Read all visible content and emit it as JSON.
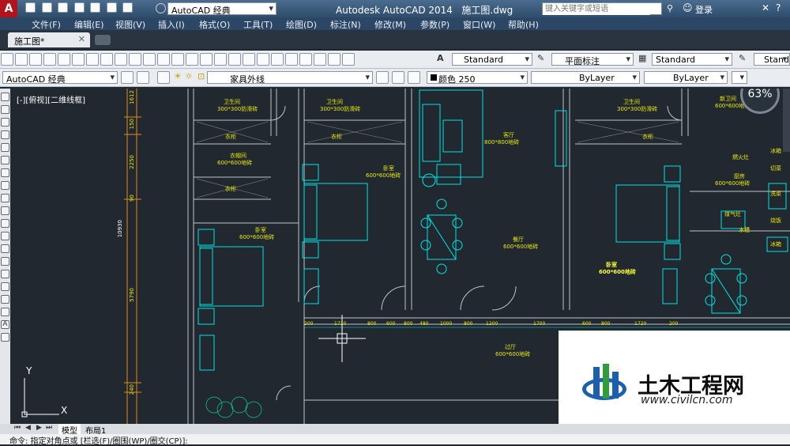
{
  "titlebar": {
    "app_icon": "A",
    "workspace": "AutoCAD 经典",
    "title_left": "Autodesk AutoCAD 2014",
    "title_file": "施工图.dwg",
    "search_placeholder": "键入关键字或短语",
    "login": "登录"
  },
  "menubar": {
    "items": [
      "文件(F)",
      "编辑(E)",
      "视图(V)",
      "插入(I)",
      "格式(O)",
      "工具(T)",
      "绘图(D)",
      "标注(N)",
      "修改(M)",
      "参数(P)",
      "窗口(W)",
      "帮助(H)"
    ]
  },
  "tabs": {
    "active": "施工图*"
  },
  "toolbar1": {
    "text_style": "Standard",
    "dim_style": "平面标注",
    "table_style": "Standard",
    "multileader_style": "Standa"
  },
  "toolbar2": {
    "workspace": "AutoCAD 经典",
    "layer": "家具外线",
    "color": "颜色 250",
    "linetype": "ByLayer",
    "lineweight": "ByLayer"
  },
  "viewport": {
    "label": "[-][俯视][二维线框]",
    "progress": "63%"
  },
  "dims": {
    "top": "1612",
    "d150": "150",
    "d2250": "2250",
    "d90": "90",
    "total": "10930",
    "d5790": "5790",
    "d240": "240"
  },
  "rooms": {
    "bath1": "卫生间",
    "bath1_tile": "300*300防滑砖",
    "bath2": "卫生间",
    "bath2_tile": "300*300防滑砖",
    "bath3": "卫生间",
    "bath3_tile": "300*300防滑砖",
    "bath4": "新卫间",
    "bath4_tile": "600*600地砖",
    "wardrobe1": "衣柜",
    "wardrobe2": "衣柜",
    "wardrobe3": "衣柜",
    "wardrobe4": "衣柜",
    "cloak": "衣帽间",
    "cloak_tile": "600*600地砖",
    "bedroom1": "卧室",
    "bedroom1_tile": "600*600地砖",
    "bedroom2": "卧室",
    "bedroom2_tile": "600*600地砖",
    "bedroom3": "卧室",
    "bedroom3_tile": "600*600地砖",
    "living": "客厅",
    "living_tile": "800*800地砖",
    "dining": "餐厅",
    "dining_tile": "600*600地砖",
    "corridor": "过厅",
    "corridor_tile": "600*600地砖",
    "kitchen": "厨房",
    "kitchen_tile": "600*600地砖",
    "stove": "燃火灶",
    "fridge_l": "冰箱",
    "cut": "切菜",
    "cook": "烧饭",
    "wash": "洗菜",
    "drain": "水槽",
    "range": "煤气灶",
    "fridge": "冰箱"
  },
  "bottom_dims": [
    "200",
    "1720",
    "800",
    "600",
    "800",
    "480",
    "1000",
    "800",
    "1200",
    "1700",
    "600",
    "800",
    "1720",
    "200"
  ],
  "bottom": {
    "tab_model": "模型",
    "tab_layout": "布局1"
  },
  "cmd": {
    "text": "命令:  指定对角点或 [栏选(F)/圈围(WP)/圈交(CP)]:"
  },
  "watermark": {
    "brand": "土木工程网",
    "url": "www.civilcn.com"
  },
  "colors": {
    "accent": "#2f4d6c",
    "cyan": "#00e5e5",
    "yellow": "#e8e800",
    "bg": "#212830"
  }
}
